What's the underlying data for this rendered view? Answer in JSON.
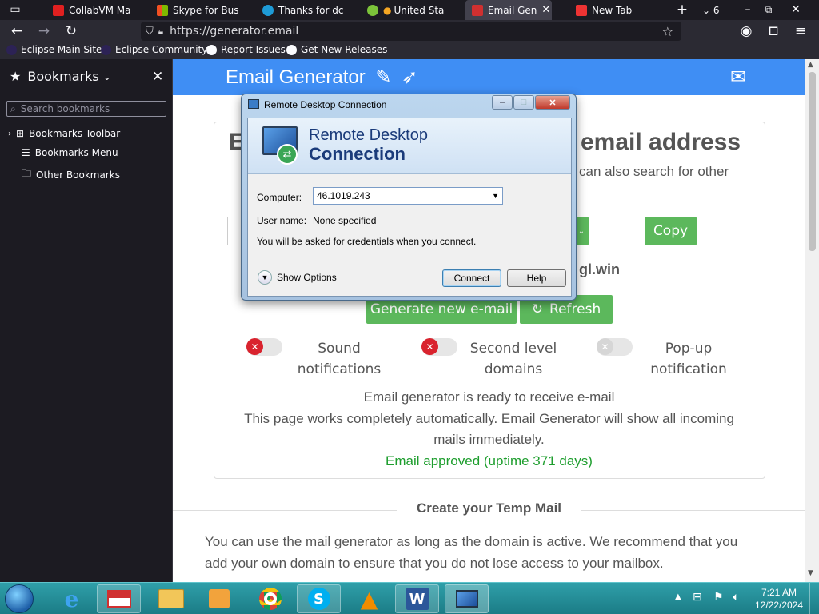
{
  "tabs": [
    {
      "title": "CollabVM Ma",
      "color": "#e02020"
    },
    {
      "title": "Skype for Bus",
      "color": "#1f6fd2"
    },
    {
      "title": "Thanks for dc",
      "color": "#1e9bd7"
    },
    {
      "title": "United Sta",
      "color": "#7cc33a"
    },
    {
      "title": "Email Gen",
      "color": "#d03030",
      "active": true
    },
    {
      "title": "New Tab",
      "color": "#e33"
    }
  ],
  "tab_count": "6",
  "nav": {
    "url": "https://generator.email"
  },
  "bookmarks_bar": [
    "Eclipse Main Site",
    "Eclipse Community",
    "Report Issues",
    "Get New Releases"
  ],
  "sidebar": {
    "title": "Bookmarks",
    "search_placeholder": "Search bookmarks",
    "items": [
      "Bookmarks Toolbar",
      "Bookmarks Menu",
      "Other Bookmarks"
    ]
  },
  "site": {
    "brand": "Email Generator",
    "heading_fragment": "E",
    "heading_right": "email address",
    "subheading_right": "can also search for other",
    "copy_label": "Copy",
    "domain_fragment": "gl.win",
    "generate_label": "Generate new e-mail",
    "refresh_label": "Refresh",
    "toggles": [
      {
        "line1": "Sound",
        "line2": "notifications",
        "state": "off"
      },
      {
        "line1": "Second level",
        "line2": "domains",
        "state": "off"
      },
      {
        "line1": "Pop-up",
        "line2": "notification",
        "state": "disabled"
      }
    ],
    "status": "Email generator is ready to receive e-mail",
    "info_line1": "This page works completely automatically. Email Generator will show all incoming",
    "info_line2": "mails immediately.",
    "approved": "Email approved (uptime 371 days)",
    "section_title": "Create your Temp Mail",
    "para_line1": "You can use the mail generator as long as the domain is active. We recommend that you",
    "para_line2": "add your own domain to ensure that you do not lose access to your mailbox."
  },
  "rdc": {
    "window_title": "Remote Desktop Connection",
    "banner_line1": "Remote Desktop",
    "banner_line2": "Connection",
    "computer_label": "Computer:",
    "computer_value": "46.1019.243",
    "username_label": "User name:",
    "username_value": "None specified",
    "note": "You will be asked for credentials when you connect.",
    "show_options": "Show Options",
    "connect_label": "Connect",
    "help_label": "Help"
  },
  "taskbar": {
    "time": "7:21 AM",
    "date": "12/22/2024",
    "apps": [
      "internet-explorer",
      "gmail",
      "file-explorer",
      "media-player",
      "chrome",
      "skype",
      "vlc",
      "word",
      "remote-desktop"
    ]
  }
}
